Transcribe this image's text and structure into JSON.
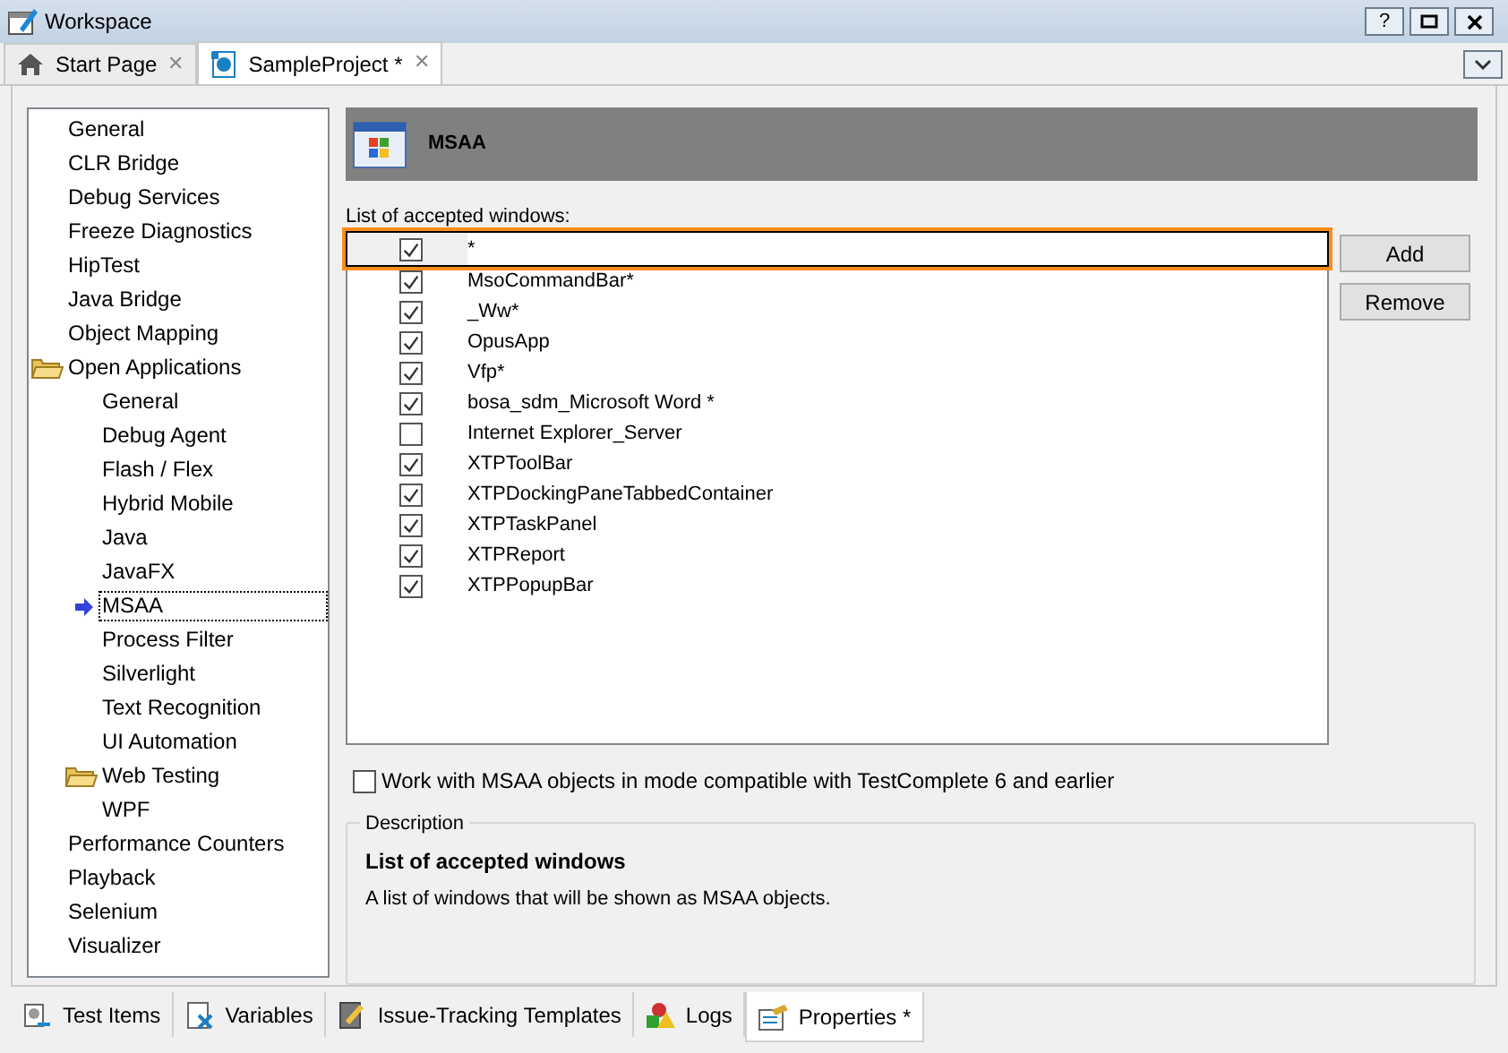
{
  "window": {
    "title": "Workspace",
    "help_button": "?"
  },
  "tabs": [
    {
      "label": "Start Page",
      "selected": false,
      "kind": "home",
      "close": "✕"
    },
    {
      "label": "SampleProject *",
      "selected": true,
      "kind": "project",
      "close": "✕"
    }
  ],
  "tree": [
    {
      "label": "General",
      "kind": "leaf",
      "selected": false
    },
    {
      "label": "CLR Bridge",
      "kind": "leaf",
      "selected": false
    },
    {
      "label": "Debug Services",
      "kind": "leaf",
      "selected": false
    },
    {
      "label": "Freeze Diagnostics",
      "kind": "leaf",
      "selected": false
    },
    {
      "label": "HipTest",
      "kind": "leaf",
      "selected": false
    },
    {
      "label": "Java Bridge",
      "kind": "leaf",
      "selected": false
    },
    {
      "label": "Object Mapping",
      "kind": "leaf",
      "selected": false
    },
    {
      "label": "Open Applications",
      "kind": "folder",
      "selected": false,
      "children": [
        {
          "label": "General",
          "kind": "leaf",
          "selected": false
        },
        {
          "label": "Debug Agent",
          "kind": "leaf",
          "selected": false
        },
        {
          "label": "Flash / Flex",
          "kind": "leaf",
          "selected": false
        },
        {
          "label": "Hybrid Mobile",
          "kind": "leaf",
          "selected": false
        },
        {
          "label": "Java",
          "kind": "leaf",
          "selected": false
        },
        {
          "label": "JavaFX",
          "kind": "leaf",
          "selected": false
        },
        {
          "label": "MSAA",
          "kind": "leaf",
          "selected": true
        },
        {
          "label": "Process Filter",
          "kind": "leaf",
          "selected": false
        },
        {
          "label": "Silverlight",
          "kind": "leaf",
          "selected": false
        },
        {
          "label": "Text Recognition",
          "kind": "leaf",
          "selected": false
        },
        {
          "label": "UI Automation",
          "kind": "leaf",
          "selected": false
        },
        {
          "label": "Web Testing",
          "kind": "folder",
          "selected": false
        },
        {
          "label": "WPF",
          "kind": "leaf",
          "selected": false
        }
      ]
    },
    {
      "label": "Performance Counters",
      "kind": "leaf",
      "selected": false
    },
    {
      "label": "Playback",
      "kind": "leaf",
      "selected": false
    },
    {
      "label": "Selenium",
      "kind": "leaf",
      "selected": false
    },
    {
      "label": "Visualizer",
      "kind": "leaf",
      "selected": false
    }
  ],
  "panel": {
    "title": "MSAA",
    "list_label": "List of accepted windows:",
    "windows": [
      {
        "name": "*",
        "checked": true,
        "selected": true
      },
      {
        "name": "MsoCommandBar*",
        "checked": true,
        "selected": false
      },
      {
        "name": "_Ww*",
        "checked": true,
        "selected": false
      },
      {
        "name": "OpusApp",
        "checked": true,
        "selected": false
      },
      {
        "name": "Vfp*",
        "checked": true,
        "selected": false
      },
      {
        "name": "bosa_sdm_Microsoft Word *",
        "checked": true,
        "selected": false
      },
      {
        "name": "Internet Explorer_Server",
        "checked": false,
        "selected": false
      },
      {
        "name": "XTPToolBar",
        "checked": true,
        "selected": false
      },
      {
        "name": "XTPDockingPaneTabbedContainer",
        "checked": true,
        "selected": false
      },
      {
        "name": "XTPTaskPanel",
        "checked": true,
        "selected": false
      },
      {
        "name": "XTPReport",
        "checked": true,
        "selected": false
      },
      {
        "name": "XTPPopupBar",
        "checked": true,
        "selected": false
      }
    ],
    "buttons": [
      "Add",
      "Remove"
    ],
    "compat_option": {
      "label": "Work with MSAA objects in mode compatible with TestComplete 6 and earlier",
      "checked": false
    },
    "description": {
      "legend": "Description",
      "heading": "List of accepted windows",
      "text": "A list of windows that will be shown as MSAA objects."
    }
  },
  "bottom_tabs": [
    {
      "label": "Test Items",
      "selected": false,
      "kind": "items"
    },
    {
      "label": "Variables",
      "selected": false,
      "kind": "variables"
    },
    {
      "label": "Issue-Tracking Templates",
      "selected": false,
      "kind": "templates"
    },
    {
      "label": "Logs",
      "selected": false,
      "kind": "logs"
    },
    {
      "label": "Properties *",
      "selected": true,
      "kind": "properties"
    }
  ]
}
